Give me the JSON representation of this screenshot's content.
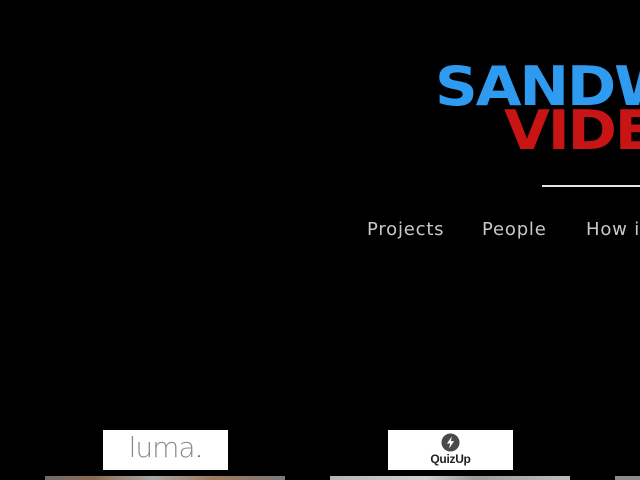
{
  "brand": {
    "line1": "SANDWICH",
    "line2": "VIDEO",
    "line1_color": "#2f9bf0",
    "line2_color": "#c81414"
  },
  "nav": {
    "items": [
      {
        "label": "Projects"
      },
      {
        "label": "People"
      },
      {
        "label": "How it works"
      }
    ]
  },
  "clients": [
    {
      "name": "luma",
      "text": "luma",
      "dot": "."
    },
    {
      "name": "QuizUp",
      "text": "QuizUp",
      "icon": "lightning-bolt-icon"
    }
  ],
  "colors": {
    "background": "#000000",
    "nav_text": "#c8c8c8",
    "divider": "#e6e6e6"
  }
}
